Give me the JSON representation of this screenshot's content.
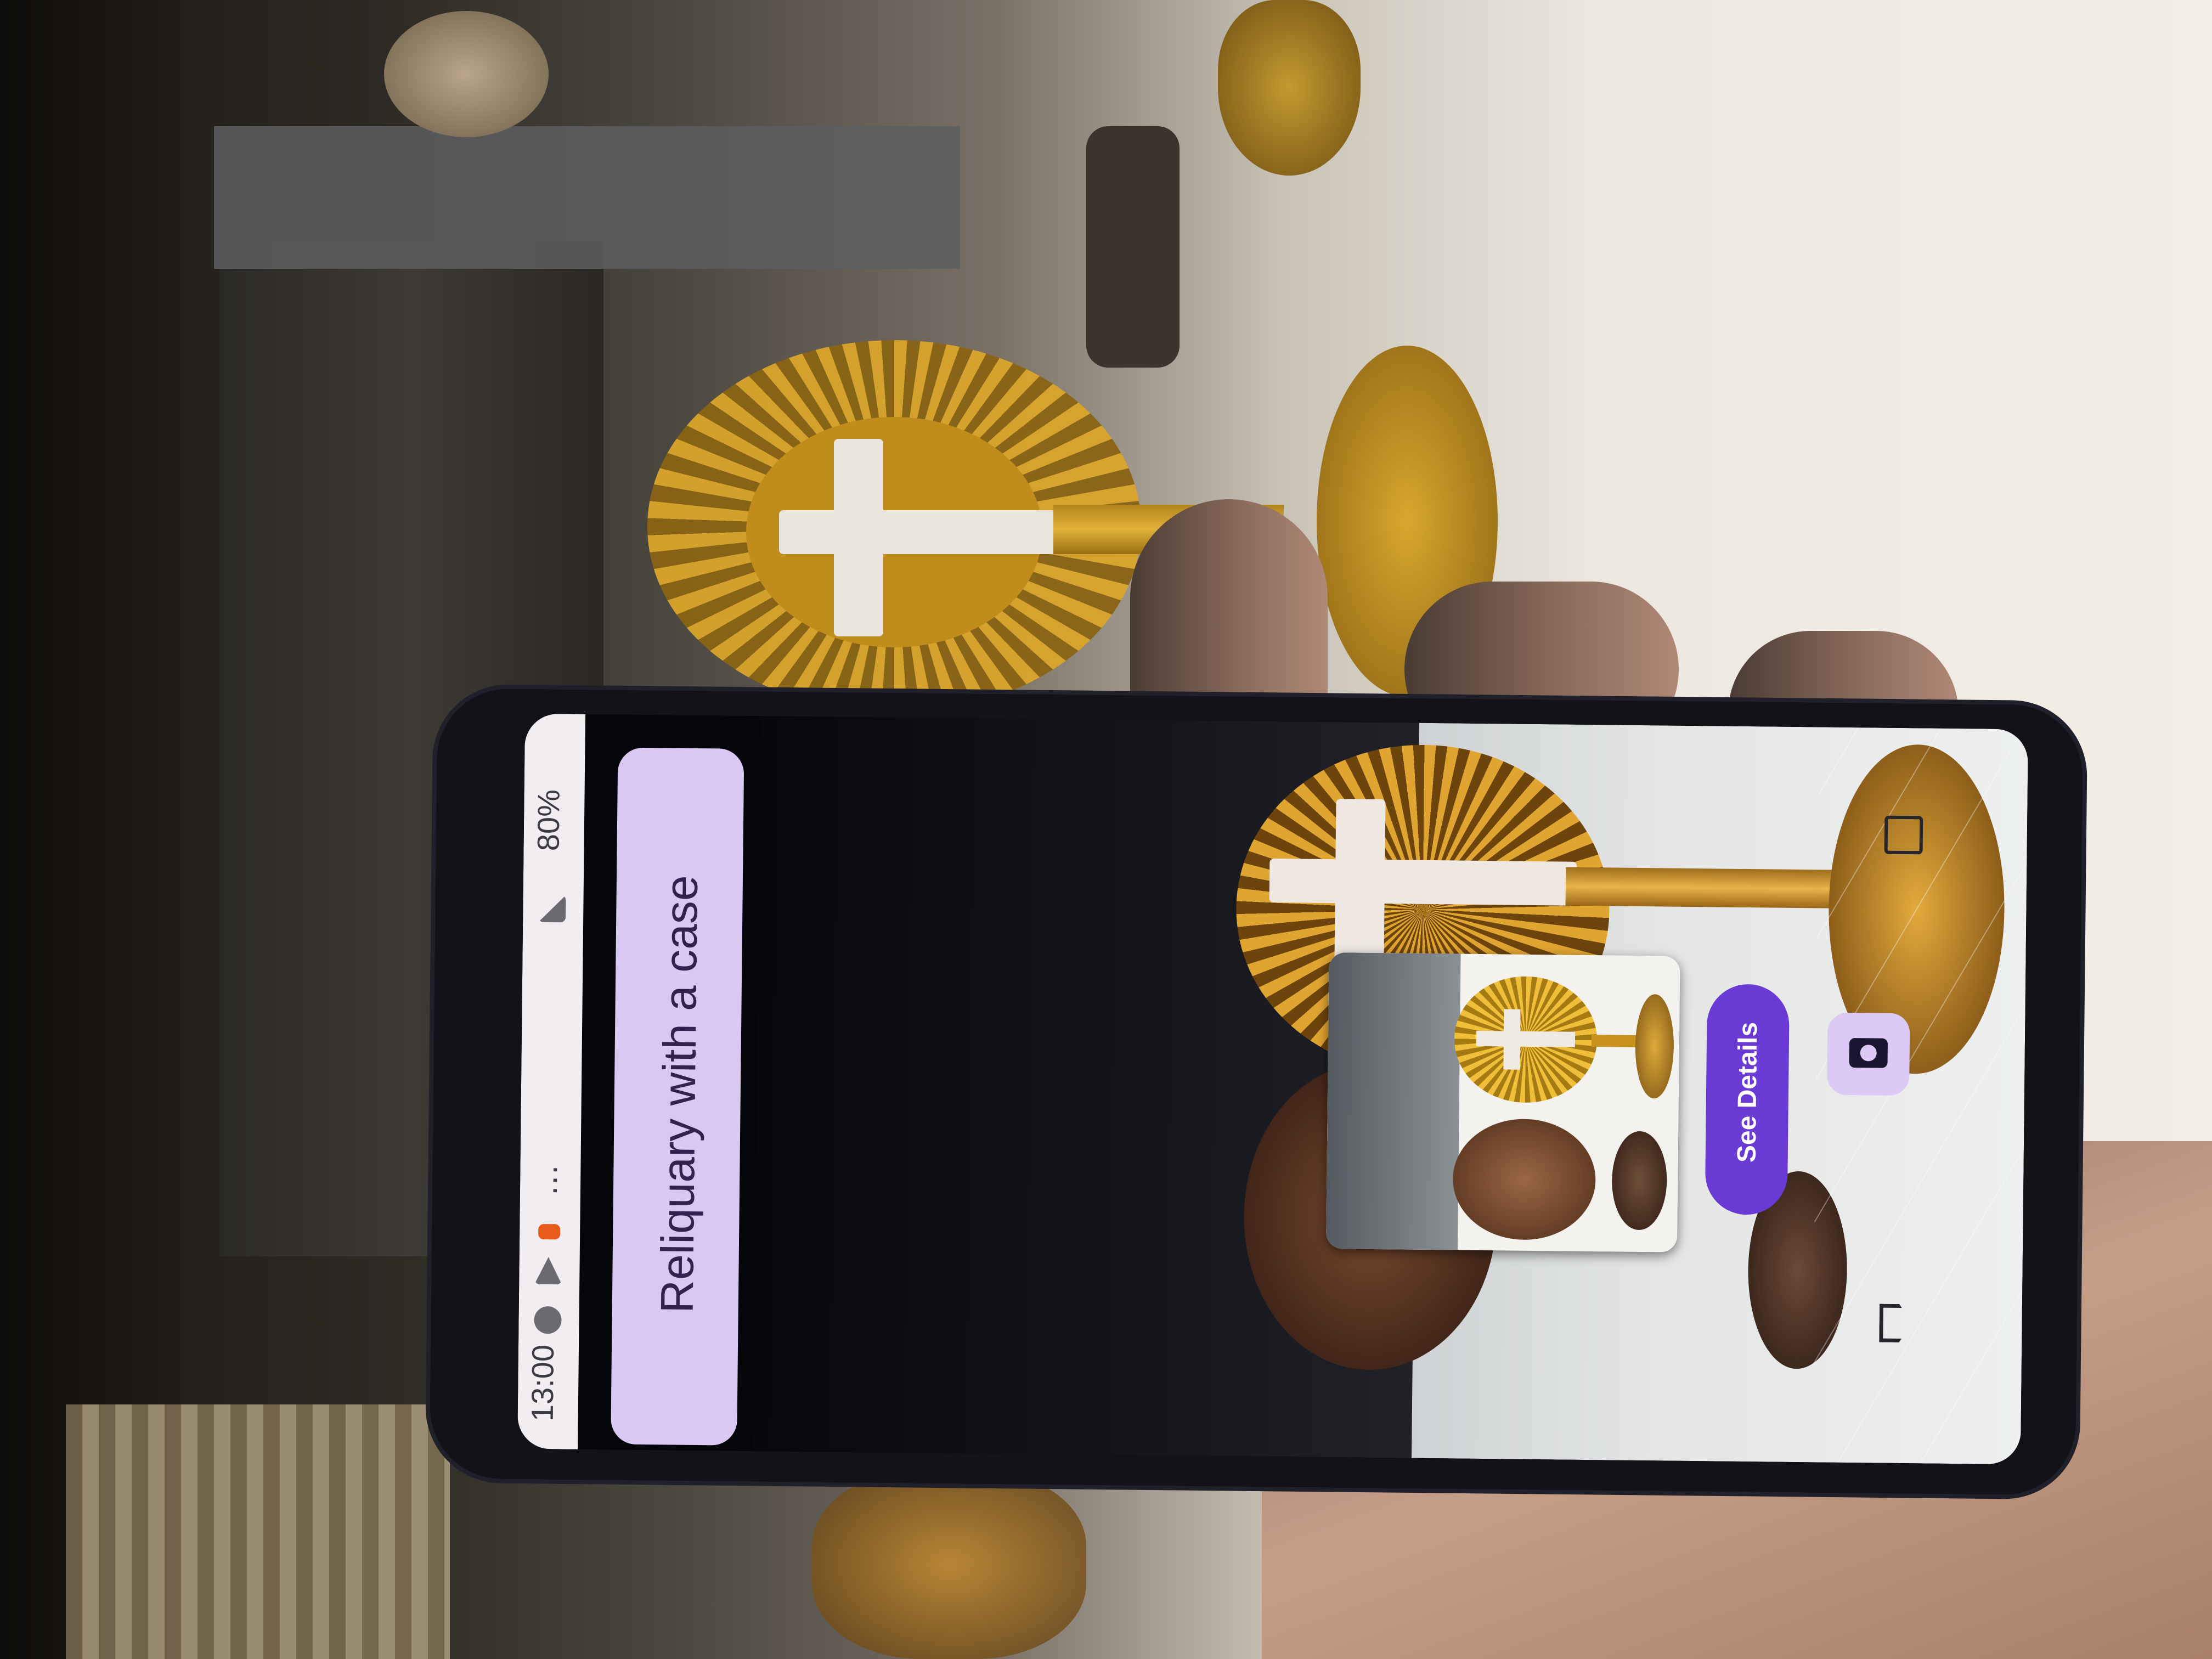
{
  "status_bar": {
    "time": "13:00",
    "battery": "80%",
    "overflow": "…"
  },
  "result": {
    "title": "Reliquary with a case"
  },
  "actions": {
    "see_details": "See Details"
  },
  "icons": {
    "shutter": "camera-icon",
    "gallery": "gallery-icon",
    "home": "home-icon"
  },
  "colors": {
    "accent": "#6a3bd4",
    "chip_bg": "#d9c8f2",
    "chip_text": "#35214f"
  }
}
